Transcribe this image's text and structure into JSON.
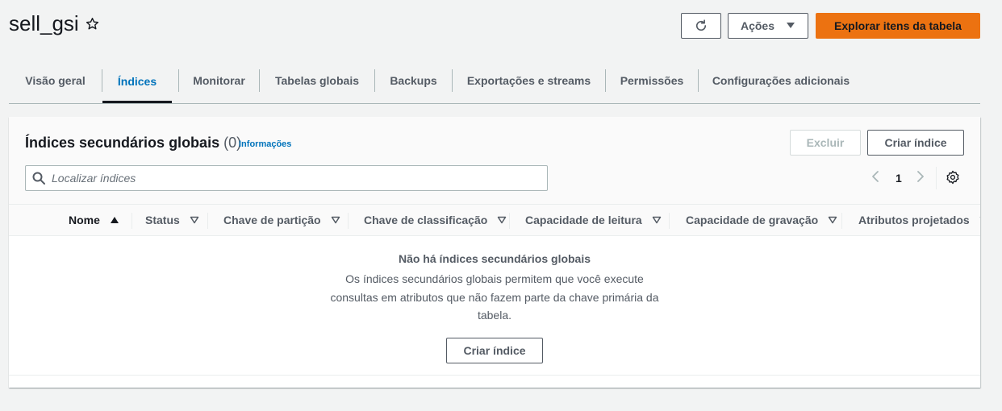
{
  "header": {
    "title": "sell_gsi",
    "actions_label": "Ações",
    "primary_label": "Explorar itens da tabela"
  },
  "tabs": [
    {
      "label": "Visão geral"
    },
    {
      "label": "Índices"
    },
    {
      "label": "Monitorar"
    },
    {
      "label": "Tabelas globais"
    },
    {
      "label": "Backups"
    },
    {
      "label": "Exportações e streams"
    },
    {
      "label": "Permissões"
    },
    {
      "label": "Configurações adicionais"
    }
  ],
  "panel": {
    "title": "Índices secundários globais",
    "count": "(0)",
    "info_link": "Informações",
    "delete_label": "Excluir",
    "create_label": "Criar índice",
    "search_placeholder": "Localizar índices",
    "page": "1"
  },
  "table": {
    "columns": [
      "Nome",
      "Status",
      "Chave de partição",
      "Chave de classificação",
      "Capacidade de leitura",
      "Capacidade de gravação",
      "Atributos projetados"
    ]
  },
  "empty": {
    "title": "Não há índices secundários globais",
    "description": "Os índices secundários globais permitem que você execute consultas em atributos que não fazem parte da chave primária da tabela.",
    "button_label": "Criar índice"
  },
  "colors": {
    "primary": "#ec7211",
    "link": "#0073bb",
    "text": "#16191f",
    "muted": "#545b64"
  }
}
